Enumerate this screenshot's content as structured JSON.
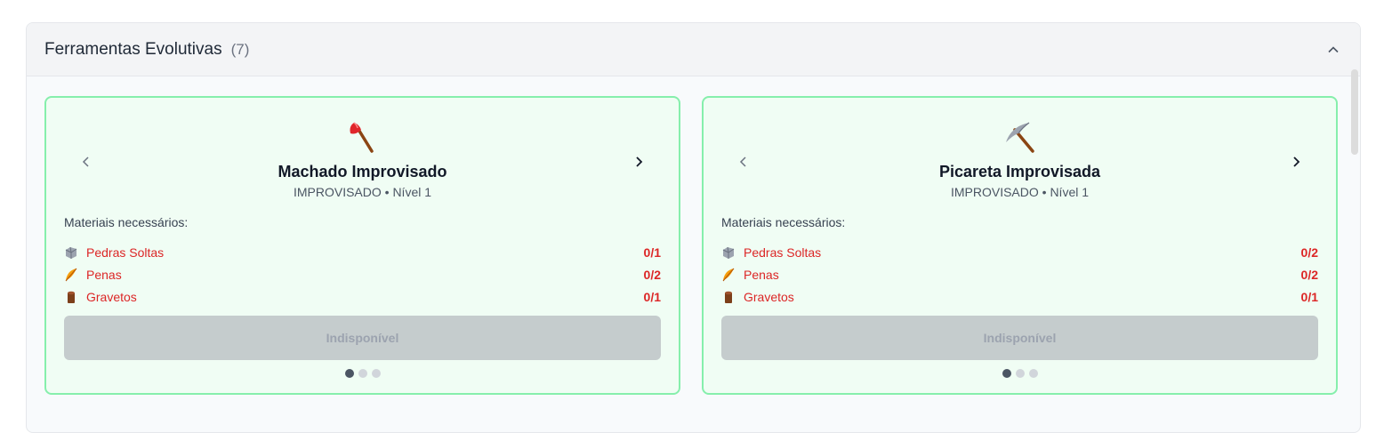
{
  "section": {
    "title": "Ferramentas Evolutivas",
    "count": "(7)"
  },
  "cards": [
    {
      "name": "Machado Improvisado",
      "meta": "IMPROVISADO • Nível 1",
      "icon": "axe-icon",
      "materials_title": "Materiais necessários:",
      "materials": [
        {
          "icon": "stone-icon",
          "name": "Pedras Soltas",
          "qty": "0/1"
        },
        {
          "icon": "feather-icon",
          "name": "Penas",
          "qty": "0/2"
        },
        {
          "icon": "wood-icon",
          "name": "Gravetos",
          "qty": "0/1"
        }
      ],
      "button": "Indisponível"
    },
    {
      "name": "Picareta Improvisada",
      "meta": "IMPROVISADO • Nível 1",
      "icon": "pickaxe-icon",
      "materials_title": "Materiais necessários:",
      "materials": [
        {
          "icon": "stone-icon",
          "name": "Pedras Soltas",
          "qty": "0/2"
        },
        {
          "icon": "feather-icon",
          "name": "Penas",
          "qty": "0/2"
        },
        {
          "icon": "wood-icon",
          "name": "Gravetos",
          "qty": "0/1"
        }
      ],
      "button": "Indisponível"
    }
  ],
  "colors": {
    "card_border": "#86efac",
    "card_bg": "#f0fdf4",
    "missing_text": "#dc2626",
    "button_disabled": "#c5cccd"
  }
}
